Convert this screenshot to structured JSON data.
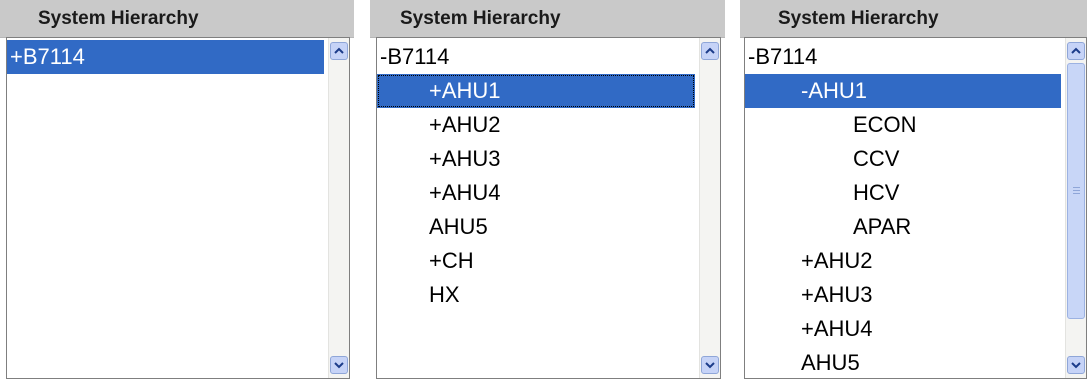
{
  "panels": [
    {
      "header": "System Hierarchy",
      "items": [
        {
          "label": "+B7114",
          "level": 0,
          "selected": true
        }
      ]
    },
    {
      "header": "System Hierarchy",
      "items": [
        {
          "label": "-B7114",
          "level": 0
        },
        {
          "label": "+AHU1",
          "level": 1,
          "selected": true
        },
        {
          "label": "+AHU2",
          "level": 1
        },
        {
          "label": "+AHU3",
          "level": 1
        },
        {
          "label": "+AHU4",
          "level": 1
        },
        {
          "label": "AHU5",
          "level": 1
        },
        {
          "label": "+CH",
          "level": 1
        },
        {
          "label": "HX",
          "level": 1
        }
      ]
    },
    {
      "header": "System Hierarchy",
      "items": [
        {
          "label": "-B7114",
          "level": 0
        },
        {
          "label": "-AHU1",
          "level": 1,
          "selected": true
        },
        {
          "label": "ECON",
          "level": 2
        },
        {
          "label": "CCV",
          "level": 2
        },
        {
          "label": "HCV",
          "level": 2
        },
        {
          "label": "APAR",
          "level": 2
        },
        {
          "label": "+AHU2",
          "level": 1
        },
        {
          "label": "+AHU3",
          "level": 1
        },
        {
          "label": "+AHU4",
          "level": 1
        },
        {
          "label": "AHU5",
          "level": 1
        }
      ]
    }
  ],
  "icons": {
    "scroll_up": "chevron-up-icon",
    "scroll_down": "chevron-down-icon"
  },
  "colors": {
    "selection": "#316ac5",
    "header_bg": "#c9c9c9",
    "scroll_button": "#c6d3f7"
  }
}
